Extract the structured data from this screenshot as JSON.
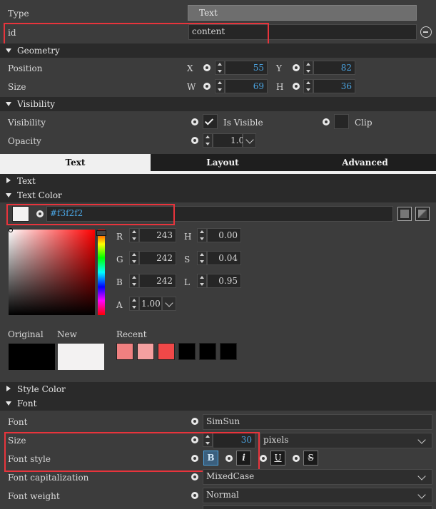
{
  "props": {
    "type_label": "Type",
    "type_value": "Text",
    "id_label": "id",
    "id_value": "content"
  },
  "geometry": {
    "header": "Geometry",
    "position_label": "Position",
    "size_label": "Size",
    "x_label": "X",
    "x_value": "55",
    "y_label": "Y",
    "y_value": "82",
    "w_label": "W",
    "w_value": "69",
    "h_label": "H",
    "h_value": "36"
  },
  "visibility": {
    "header": "Visibility",
    "visibility_label": "Visibility",
    "is_visible_label": "Is Visible",
    "is_visible": true,
    "clip_label": "Clip",
    "clip": false,
    "opacity_label": "Opacity",
    "opacity_value": "1.00"
  },
  "tabs": [
    "Text",
    "Layout",
    "Advanced"
  ],
  "text_section": {
    "header": "Text",
    "text_color_header": "Text Color",
    "hex_value": "#f3f2f2",
    "r_label": "R",
    "r_value": "243",
    "g_label": "G",
    "g_value": "242",
    "b_label": "B",
    "b_value": "242",
    "a_label": "A",
    "a_value": "1.00",
    "h_label": "H",
    "h_value": "0.00",
    "s_label": "S",
    "s_value": "0.04",
    "l_label": "L",
    "l_value": "0.95",
    "original_label": "Original",
    "new_label": "New",
    "recent_label": "Recent",
    "original_color": "#000000",
    "new_color": "#f3f2f2",
    "recent_colors": [
      "#f08080",
      "#f4a0a0",
      "#f04848",
      "#000000",
      "#000000",
      "#000000"
    ]
  },
  "style_color": {
    "header": "Style Color"
  },
  "font": {
    "header": "Font",
    "font_label": "Font",
    "font_value": "SimSun",
    "size_label": "Size",
    "size_value": "30",
    "size_unit": "pixels",
    "style_label": "Font style",
    "bold_glyph": "B",
    "italic_glyph": "i",
    "underline_glyph": "U",
    "strike_glyph": "S",
    "capitalization_label": "Font capitalization",
    "capitalization_value": "MixedCase",
    "weight_label": "Font weight",
    "weight_value": "Normal"
  },
  "colors": {
    "highlight": "#e8343c",
    "accent_number": "#4aa3e0",
    "active_tab_bg": "#f0f0f0"
  }
}
